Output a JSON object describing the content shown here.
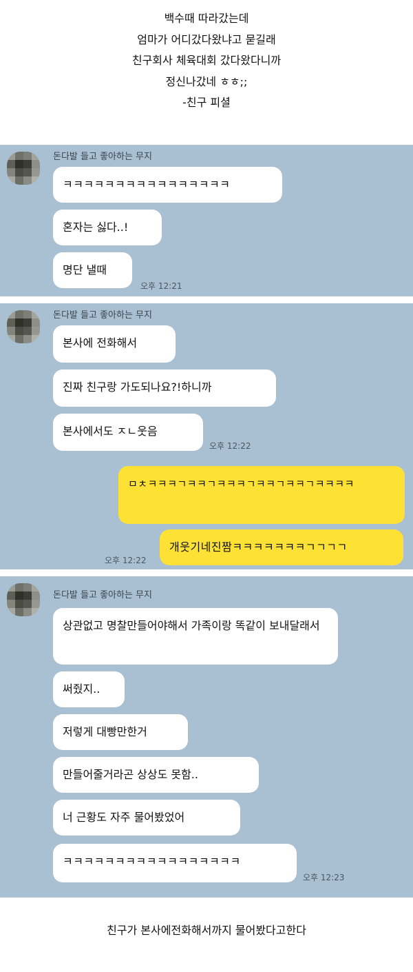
{
  "top_caption": {
    "line1": "백수때 따라갔는데",
    "line2": "엄마가 어디갔다왔냐고 묻길래",
    "line3": "친구회사 체육대회 갔다왔다니까",
    "line4": "정신나갔네 ㅎㅎ;;",
    "line5": "-친구 피셜"
  },
  "chat1": {
    "sender": "돈다발 들고 좋아하는 무지",
    "messages": [
      "ㅋㅋㅋㅋㅋㅋㅋㅋㅋㅋㅋㅋㅋㅋㅋㅋ",
      "혼자는 싫다..!",
      "명단 낼때"
    ],
    "time": "오후 12:21"
  },
  "chat2": {
    "sender": "돈다발 들고 좋아하는 무지",
    "messages": [
      "본사에 전화해서",
      "진짜 친구랑 가도되나요?!하니까",
      "본사에서도 ㅈㄴ웃음"
    ],
    "time": "오후 12:22",
    "my_messages": [
      "ㅁㅊㅋㅋㅋㄱㅋㅋㄱㅋㅋㅋㄱㅋㅋㄱㅋㅋㄱㅋㅋㅋㅋ",
      "개웃기네진짬ㅋㅋㅋㅋㅋㅋㅋㄱㄱㄱㄱ"
    ],
    "my_time": "오후 12:22"
  },
  "chat3": {
    "sender": "돈다발 들고 좋아하는 무지",
    "messages": [
      "상관없고 명찰만들어야해서 가족이랑 똑같이 보내달래서",
      "써줬지..",
      "저렇게 대빵만한거",
      "만들어줄거라곤 상상도 못함..",
      "너 근황도 자주 물어봤었어",
      "ㅋㅋㅋㅋㅋㅋㅋㅋㅋㅋㅋㅋㅋㅋㅋㅋㅋ"
    ],
    "time": "오후 12:23"
  },
  "bottom_caption": "친구가 본사에전화해서까지 물어봤다고한다",
  "colors": {
    "chat_background": "#a9bfd2",
    "incoming_bubble": "#ffffff",
    "outgoing_bubble": "#fde135"
  },
  "icons": {
    "avatar": "pixelated-profile-avatar"
  }
}
